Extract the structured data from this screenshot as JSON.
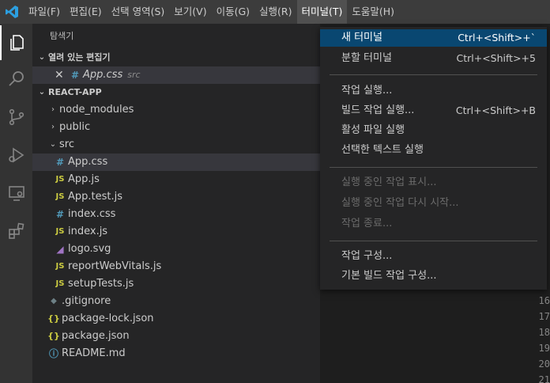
{
  "menubar": {
    "items": [
      "파일(F)",
      "편집(E)",
      "선택 영역(S)",
      "보기(V)",
      "이동(G)",
      "실행(R)",
      "터미널(T)",
      "도움말(H)"
    ],
    "active_index": 6
  },
  "activity_icons": [
    "explorer-icon",
    "search-icon",
    "source-control-icon",
    "run-debug-icon",
    "remote-explorer-icon",
    "extensions-icon"
  ],
  "sidebar": {
    "title": "탐색기",
    "open_editors": {
      "header": "열려 있는 편집기",
      "files": [
        {
          "name": "App.css",
          "folder": "src"
        }
      ]
    },
    "project": {
      "header": "REACT-APP",
      "tree": [
        {
          "label": "node_modules",
          "type": "folder",
          "icon": "chevron-right-icon"
        },
        {
          "label": "public",
          "type": "folder",
          "icon": "chevron-right-icon"
        },
        {
          "label": "src",
          "type": "folder-open",
          "icon": "chevron-down-icon"
        },
        {
          "label": "App.css",
          "type": "css",
          "icon": "#",
          "selected": true
        },
        {
          "label": "App.js",
          "type": "js",
          "icon": "JS"
        },
        {
          "label": "App.test.js",
          "type": "js",
          "icon": "JS"
        },
        {
          "label": "index.css",
          "type": "css",
          "icon": "#"
        },
        {
          "label": "index.js",
          "type": "js",
          "icon": "JS"
        },
        {
          "label": "logo.svg",
          "type": "svg",
          "icon": "◢"
        },
        {
          "label": "reportWebVitals.js",
          "type": "js",
          "icon": "JS"
        },
        {
          "label": "setupTests.js",
          "type": "js",
          "icon": "JS"
        },
        {
          "label": ".gitignore",
          "type": "git",
          "icon": "◆"
        },
        {
          "label": "package-lock.json",
          "type": "json",
          "icon": "{}"
        },
        {
          "label": "package.json",
          "type": "json",
          "icon": "{}"
        },
        {
          "label": "README.md",
          "type": "info",
          "icon": "ⓘ"
        }
      ]
    }
  },
  "editor": {
    "line_numbers": [
      "16",
      "17",
      "18",
      "19",
      "20",
      "21"
    ]
  },
  "terminal_menu": {
    "groups": [
      [
        {
          "label": "새 터미널",
          "shortcut": "Ctrl+<Shift>+`",
          "highlighted": true
        },
        {
          "label": "분할 터미널",
          "shortcut": "Ctrl+<Shift>+5"
        }
      ],
      [
        {
          "label": "작업 실행..."
        },
        {
          "label": "빌드 작업 실행...",
          "shortcut": "Ctrl+<Shift>+B"
        },
        {
          "label": "활성 파일 실행"
        },
        {
          "label": "선택한 텍스트 실행"
        }
      ],
      [
        {
          "label": "실행 중인 작업 표시...",
          "disabled": true
        },
        {
          "label": "실행 중인 작업 다시 시작...",
          "disabled": true
        },
        {
          "label": "작업 종료...",
          "disabled": true
        }
      ],
      [
        {
          "label": "작업 구성..."
        },
        {
          "label": "기본 빌드 작업 구성..."
        }
      ]
    ]
  }
}
